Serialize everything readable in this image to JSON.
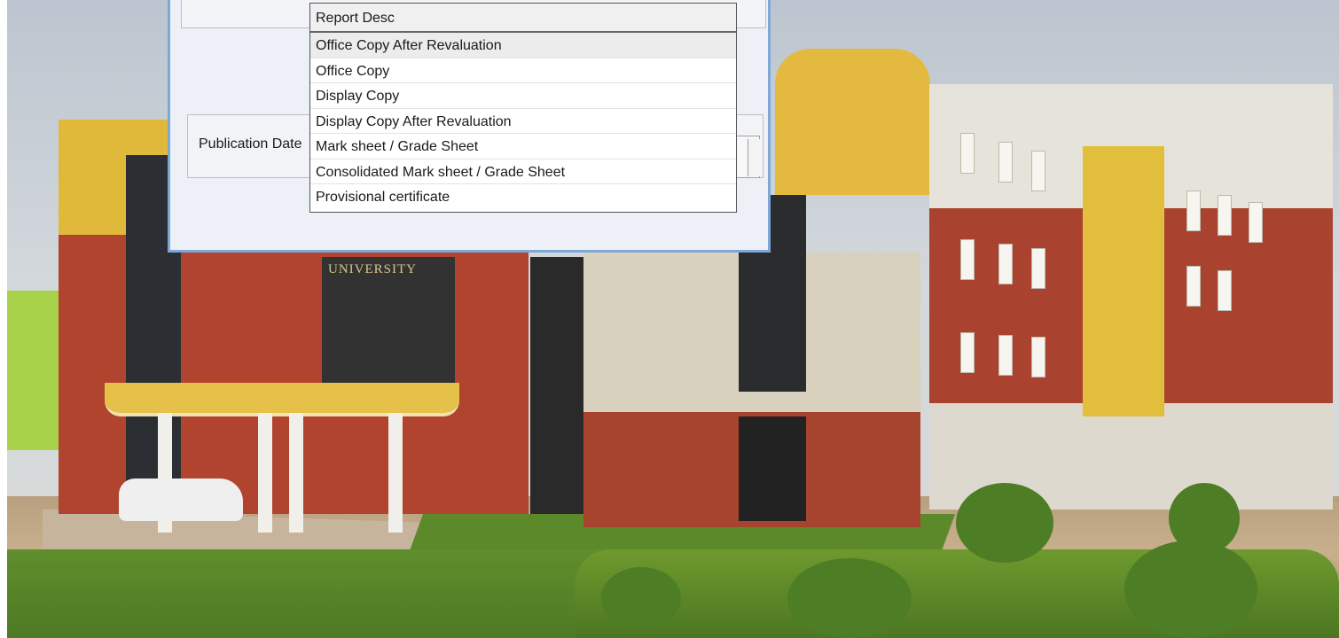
{
  "background": {
    "sign_text": "UNIVERSITY"
  },
  "dialog": {
    "publication_date_label": "Publication Date",
    "publication_date_value": ""
  },
  "dropdown": {
    "header": "Report Desc",
    "items": [
      "Office Copy After Revaluation",
      "Office Copy",
      "Display Copy",
      "Display Copy After Revaluation",
      "Mark sheet / Grade Sheet",
      "Consolidated Mark sheet / Grade Sheet",
      "Provisional certificate"
    ],
    "highlighted_index": 0
  },
  "colors": {
    "dialog_border": "#7ea8d8",
    "dialog_bg": "#edf1f7",
    "highlight": "#ececec"
  }
}
